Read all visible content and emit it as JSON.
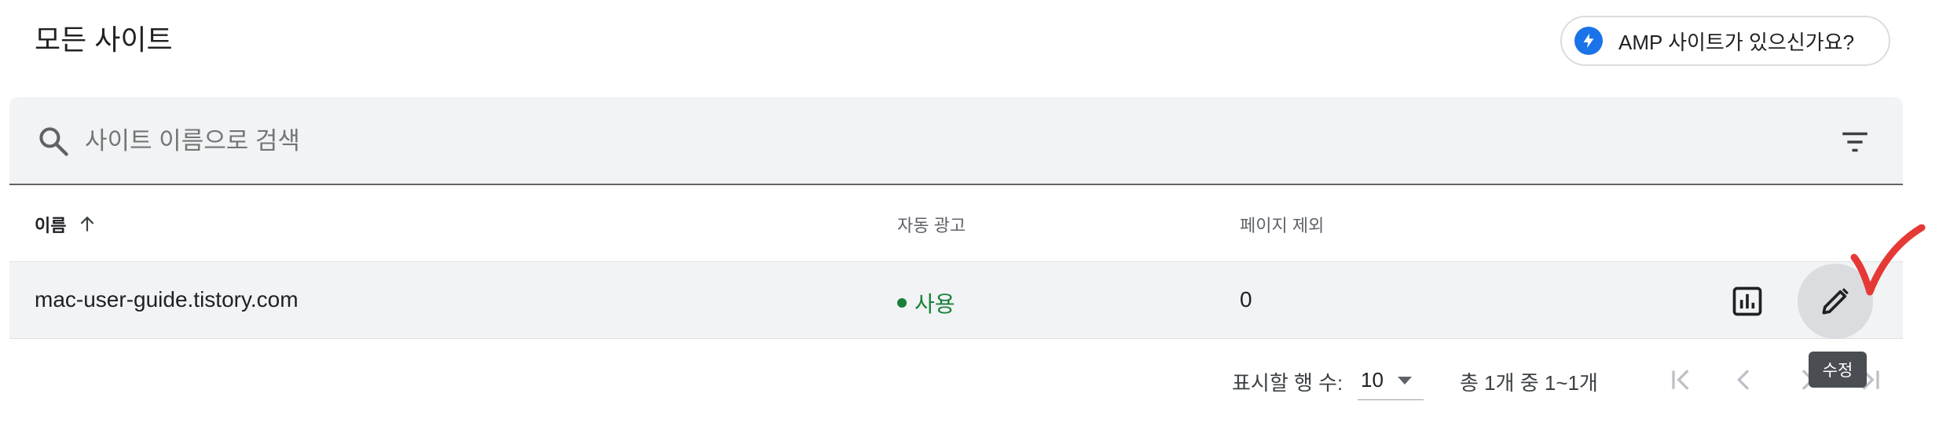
{
  "header": {
    "title": "모든 사이트",
    "amp_link_label": "AMP 사이트가 있으신가요?"
  },
  "search": {
    "placeholder": "사이트 이름으로 검색",
    "value": ""
  },
  "table": {
    "columns": [
      "이름",
      "자동 광고",
      "페이지 제외"
    ],
    "sort": {
      "column": "이름",
      "direction": "ascending"
    },
    "rows": [
      {
        "site": "mac-user-guide.tistory.com",
        "auto_ads": "사용",
        "excluded_pages": "0"
      }
    ]
  },
  "pagination": {
    "rows_per_page_label": "표시할 행 수:",
    "rows_per_page": "10",
    "range_text": "총 1개 중 1~1개"
  },
  "tooltip": {
    "text": "수정"
  },
  "colors": {
    "accent": "#1a73e8",
    "status_on": "#188038",
    "panel_bg": "#f1f3f4",
    "annotation": "#e53935"
  },
  "icons": [
    "bolt-icon",
    "search-icon",
    "filter-icon",
    "arrow-up-icon",
    "bar-chart-icon",
    "pencil-icon",
    "first-page-icon",
    "chevron-left-icon",
    "chevron-right-icon",
    "last-page-icon",
    "checkmark-annotation-icon"
  ]
}
